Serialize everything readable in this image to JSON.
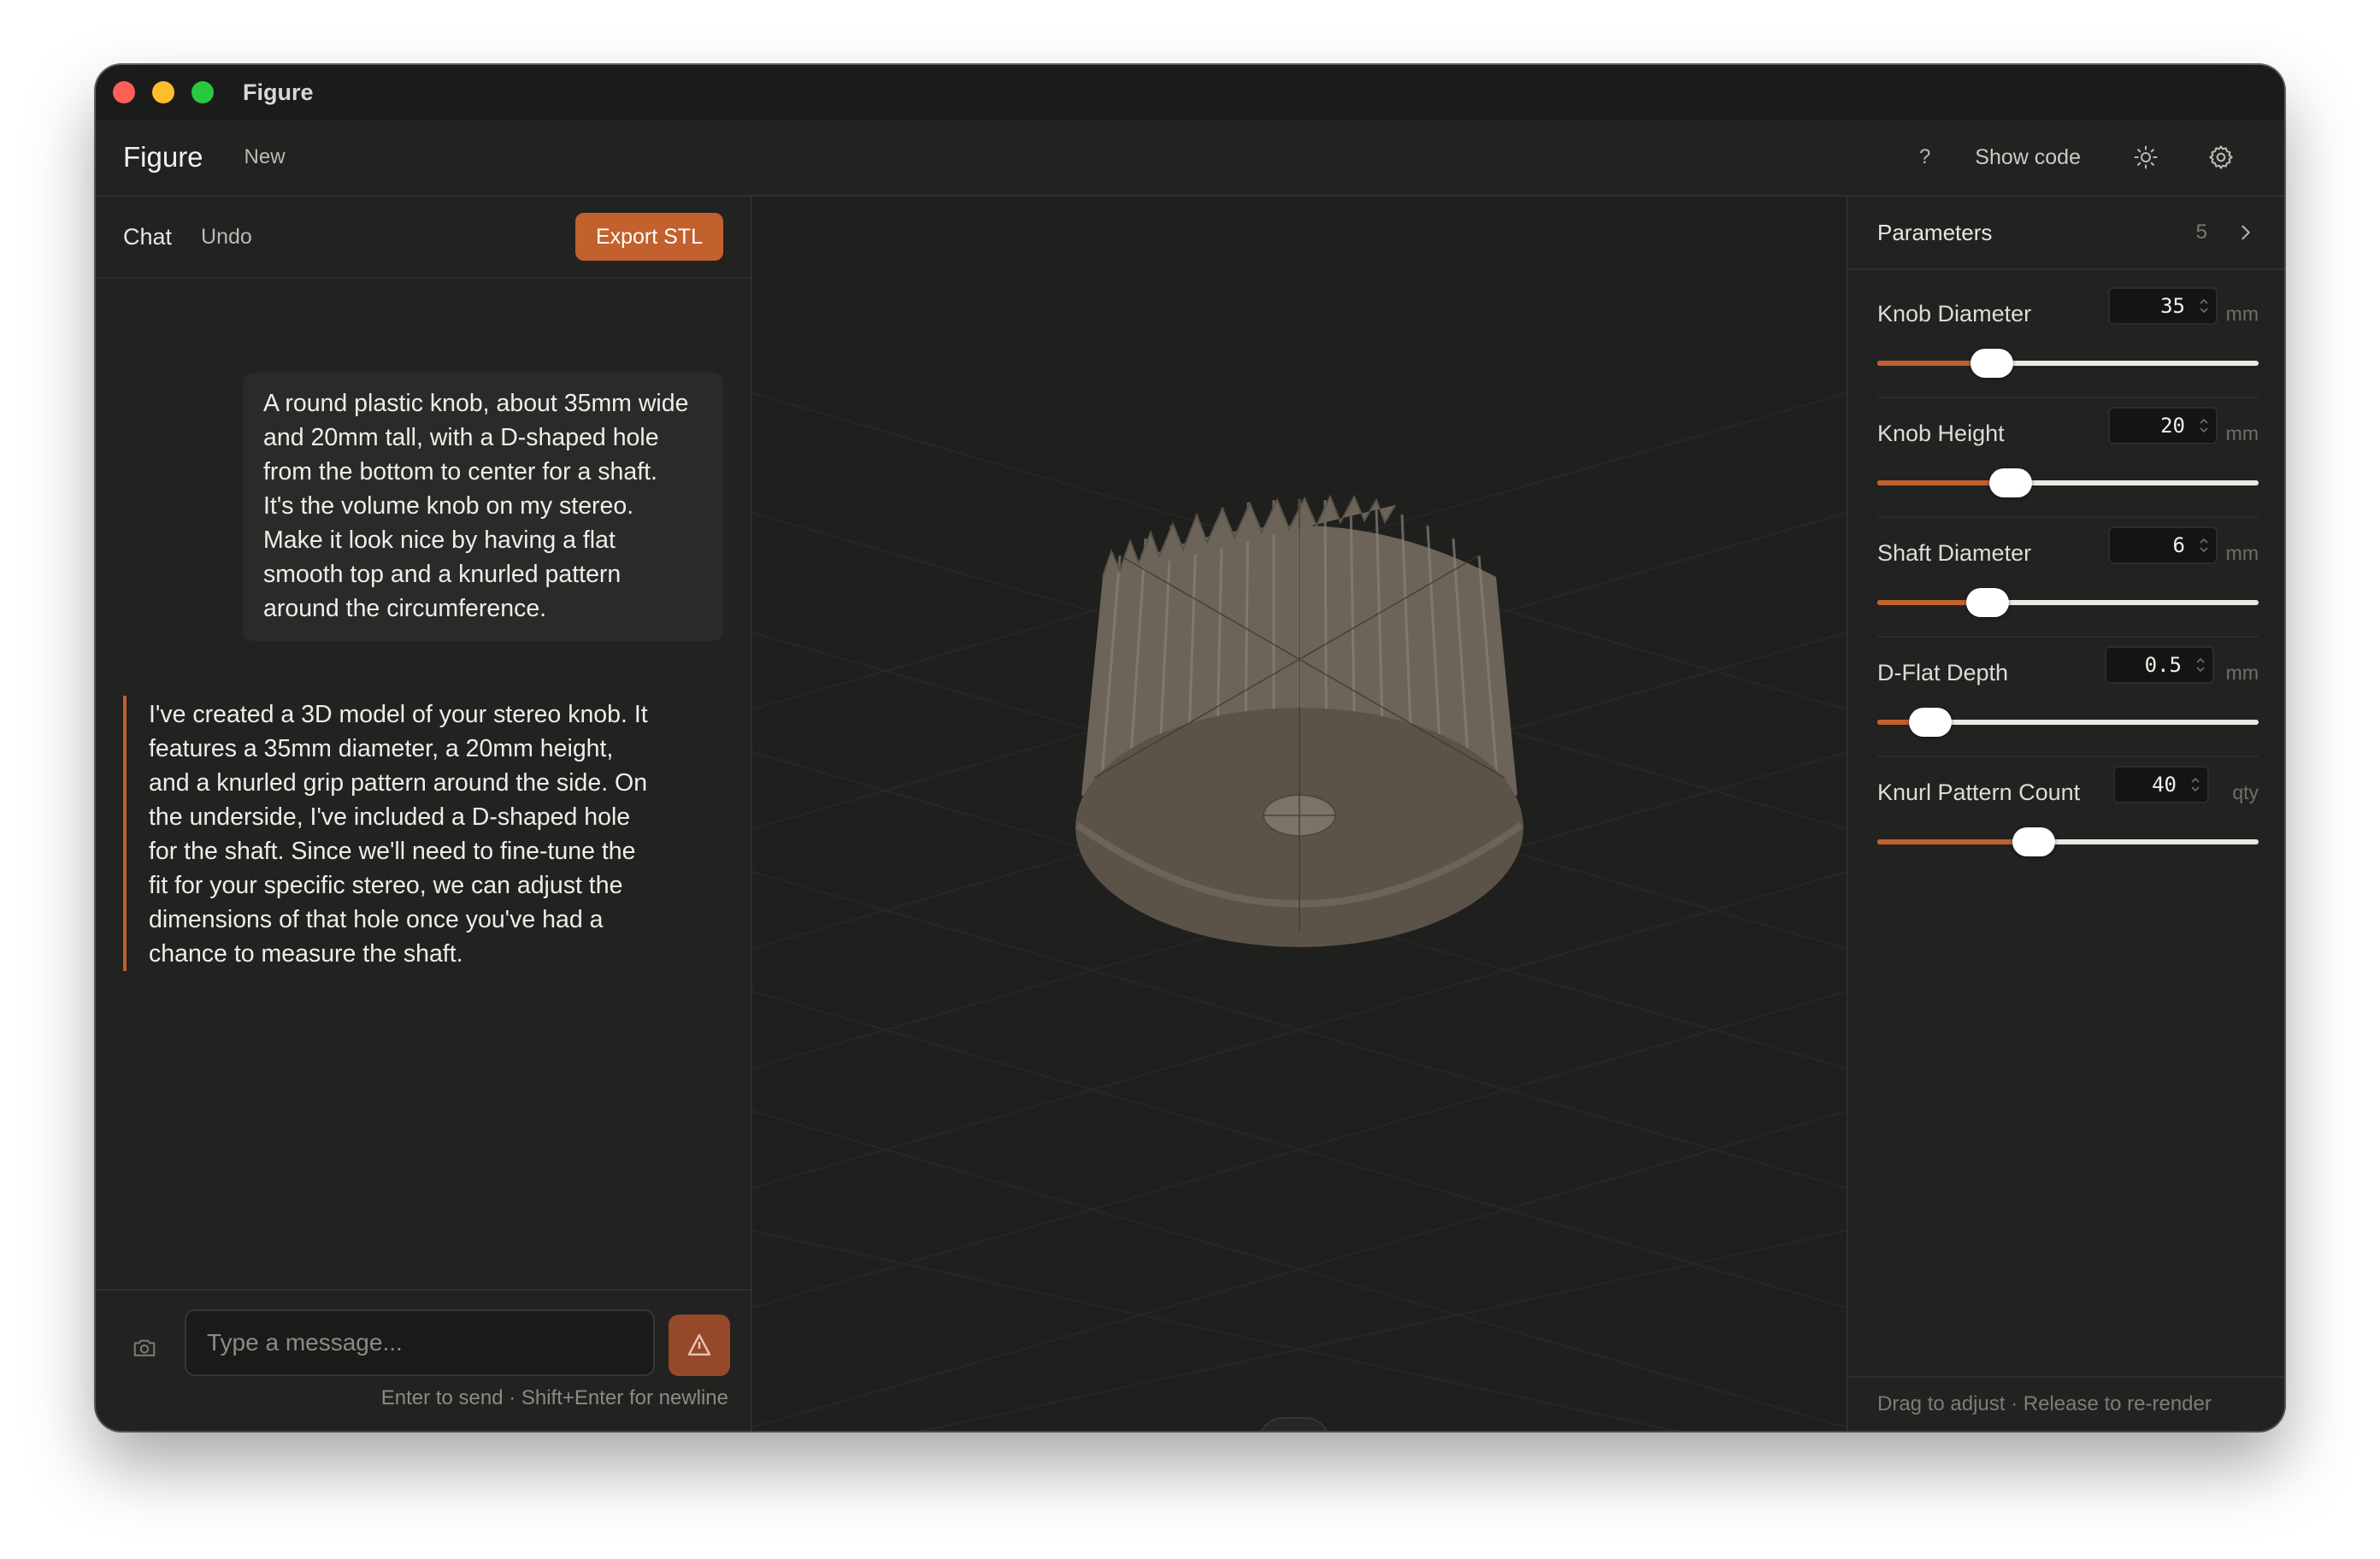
{
  "window": {
    "title": "Figure"
  },
  "appbar": {
    "brand": "Figure",
    "new_label": "New",
    "help_label": "?",
    "show_code_label": "Show code",
    "theme_icon": "sun-icon",
    "settings_icon": "gear-icon"
  },
  "chat": {
    "tab_label": "Chat",
    "undo_label": "Undo",
    "export_label": "Export STL",
    "messages": [
      {
        "role": "user",
        "text": "A round plastic knob, about 35mm wide\nand 20mm tall, with a D-shaped hole\nfrom the bottom to center for a shaft.\nIt's the volume knob on my stereo.\nMake it look nice by having a flat\nsmooth top and a knurled pattern\naround the circumference."
      },
      {
        "role": "assistant",
        "text": "I've created a 3D model of your stereo knob. It\nfeatures a 35mm diameter, a 20mm height,\nand a knurled grip pattern around the side. On\nthe underside, I've included a D-shaped hole\nfor the shaft. Since we'll need to fine-tune the\nfit for your specific stereo, we can adjust the\ndimensions of that hole once you've had a\nchance to measure the shaft."
      }
    ],
    "input_placeholder": "Type a message...",
    "input_value": "",
    "hint": "Enter to send · Shift+Enter for newline",
    "camera_icon": "camera-icon",
    "send_icon": "send-icon"
  },
  "viewport": {
    "pin_icon": "pin-icon"
  },
  "parameters": {
    "title": "Parameters",
    "count": "5",
    "items": [
      {
        "label": "Knob Diameter",
        "value": "35",
        "unit": "mm",
        "fraction": 0.3
      },
      {
        "label": "Knob Height",
        "value": "20",
        "unit": "mm",
        "fraction": 0.35
      },
      {
        "label": "Shaft Diameter",
        "value": "6",
        "unit": "mm",
        "fraction": 0.29
      },
      {
        "label": "D-Flat Depth",
        "value": "0.5",
        "unit": "mm",
        "fraction": 0.14
      },
      {
        "label": "Knurl Pattern Count",
        "value": "40",
        "unit": "qty",
        "fraction": 0.41
      }
    ],
    "footer": "Drag to adjust · Release to re-render"
  },
  "colors": {
    "accent": "#c2602e",
    "background": "#232321",
    "model": "#6f665b"
  }
}
